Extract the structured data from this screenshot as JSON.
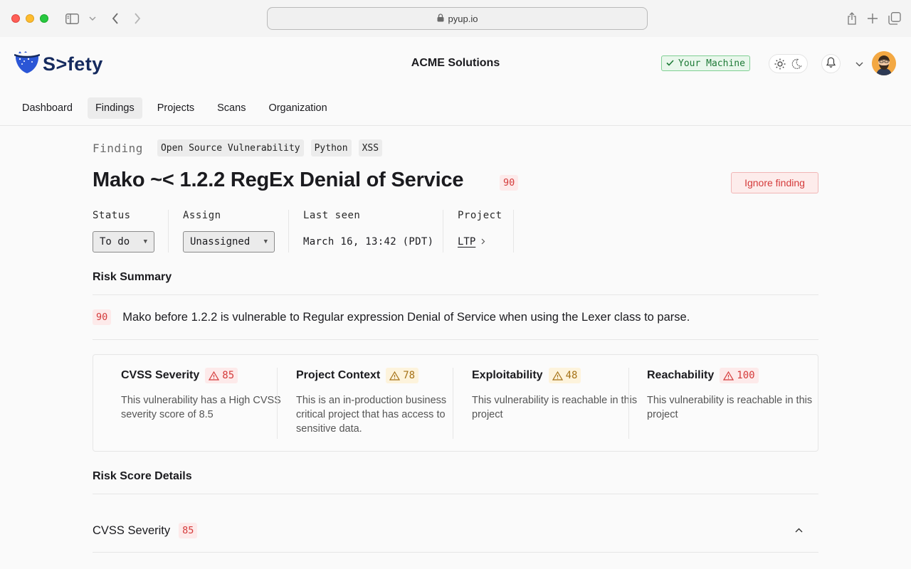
{
  "browser": {
    "url": "pyup.io"
  },
  "header": {
    "logo_text": "S>fety",
    "org_name": "ACME Solutions",
    "machine_badge": "Your Machine"
  },
  "nav": {
    "items": [
      {
        "label": "Dashboard",
        "active": false
      },
      {
        "label": "Findings",
        "active": true
      },
      {
        "label": "Projects",
        "active": false
      },
      {
        "label": "Scans",
        "active": false
      },
      {
        "label": "Organization",
        "active": false
      }
    ]
  },
  "finding": {
    "label": "Finding",
    "tags": [
      "Open Source Vulnerability",
      "Python",
      "XSS"
    ],
    "title": "Mako ~< 1.2.2 RegEx Denial of Service",
    "score": "90",
    "ignore_label": "Ignore finding",
    "meta": {
      "status_label": "Status",
      "status_value": "To do",
      "assign_label": "Assign",
      "assign_value": "Unassigned",
      "last_seen_label": "Last seen",
      "last_seen_value": "March 16, 13:42 (PDT)",
      "project_label": "Project",
      "project_value": "LTP"
    }
  },
  "risk_summary": {
    "heading": "Risk Summary",
    "score": "90",
    "text": "Mako before 1.2.2 is vulnerable to Regular expression Denial of Service when using the Lexer class to parse."
  },
  "risk_cards": [
    {
      "title": "CVSS Severity",
      "score": "85",
      "severity": "red",
      "desc": "This vulnerability has a High CVSS severity score of 8.5"
    },
    {
      "title": "Project Context",
      "score": "78",
      "severity": "amber",
      "desc": "This is an in-production business critical project that has access to sensitive data."
    },
    {
      "title": "Exploitability",
      "score": "48",
      "severity": "amber",
      "desc": "This vulnerability is reachable in this project"
    },
    {
      "title": "Reachability",
      "score": "100",
      "severity": "red",
      "desc": "This vulnerability is reachable in this project"
    }
  ],
  "risk_details": {
    "heading": "Risk Score Details",
    "rows": [
      {
        "title": "CVSS Severity",
        "score": "85",
        "expanded": true
      }
    ]
  },
  "colors": {
    "brand": "#152a5e",
    "danger": "#d43a3a",
    "warning": "#a57217",
    "success": "#1d7a36"
  }
}
